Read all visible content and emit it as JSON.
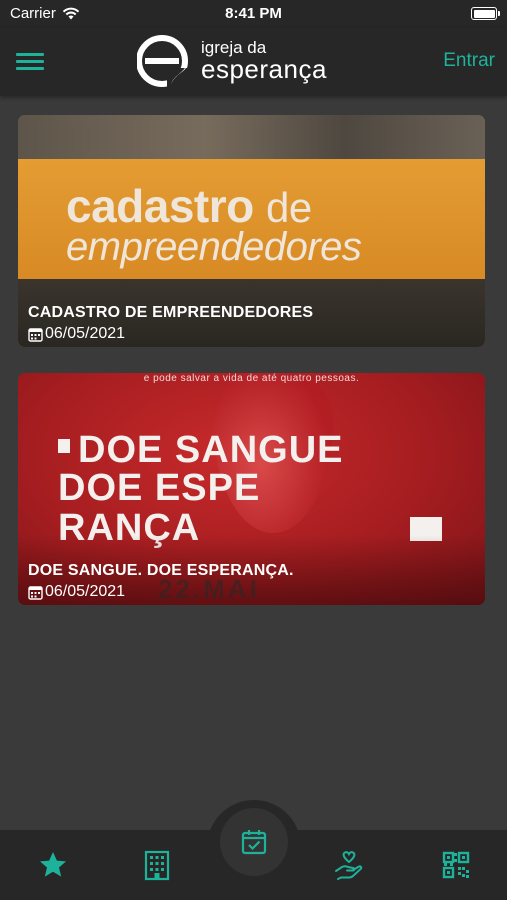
{
  "status_bar": {
    "carrier": "Carrier",
    "time": "8:41 PM"
  },
  "nav": {
    "menu_icon": "hamburger-icon",
    "logo_line1": "igreja da",
    "logo_line2": "esperança",
    "login_label": "Entrar"
  },
  "colors": {
    "accent": "#1db39a",
    "bar": "#272727",
    "background": "#3a3a3a"
  },
  "posts": [
    {
      "banner_line1": "cadastro",
      "banner_line1b": "de",
      "banner_line2": "empreendedores",
      "title": "CADASTRO DE EMPREENDEDORES",
      "date": "06/05/2021"
    },
    {
      "banner_top": "e pode salvar a vida de até quatro pessoas.",
      "banner_line1": "DOE SANGUE",
      "banner_line2": "DOE ESPE",
      "banner_line3": "RANÇA",
      "banner_faint": "22.MAI",
      "title": "DOE SANGUE. DOE ESPERANÇA.",
      "date": "06/05/2021"
    }
  ],
  "tabs": [
    {
      "icon": "star-icon"
    },
    {
      "icon": "building-icon"
    },
    {
      "icon": "calendar-check-icon"
    },
    {
      "icon": "hand-heart-icon"
    },
    {
      "icon": "qr-code-icon"
    }
  ]
}
